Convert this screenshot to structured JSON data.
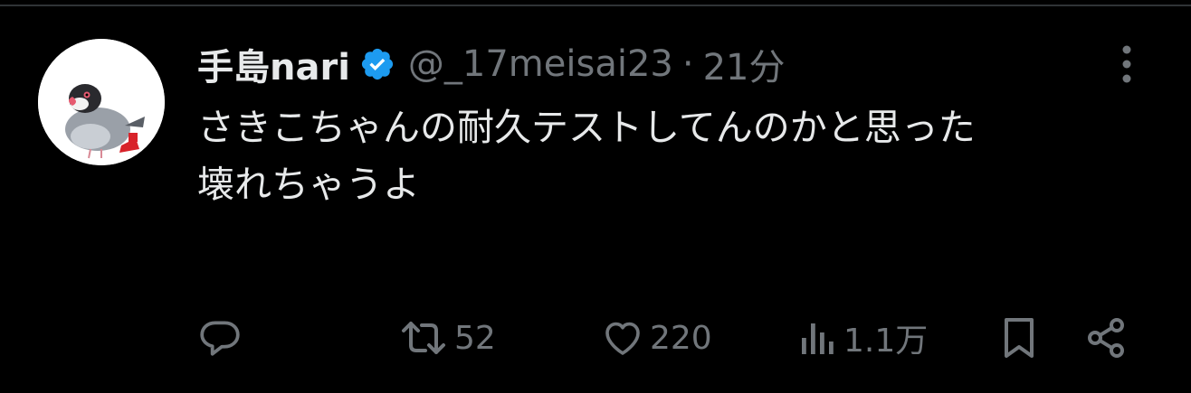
{
  "tweet": {
    "author": {
      "display_name": "手島nari",
      "handle": "@_17meisai23",
      "verified": true,
      "avatar_icon": "java-sparrow-avatar"
    },
    "separator": "·",
    "time": "21分",
    "text": "さきこちゃんの耐久テストしてんのかと思った\n壊れちゃうよ",
    "actions": {
      "reply": {
        "icon": "reply-icon",
        "count": ""
      },
      "retweet": {
        "icon": "retweet-icon",
        "count": "52"
      },
      "like": {
        "icon": "heart-icon",
        "count": "220"
      },
      "views": {
        "icon": "views-icon",
        "count": "1.1万"
      },
      "bookmark": {
        "icon": "bookmark-icon"
      },
      "share": {
        "icon": "share-icon"
      }
    },
    "more_icon": "more-vertical-icon"
  },
  "colors": {
    "background": "#000000",
    "primary_text": "#e7e9ea",
    "secondary_text": "#71767b",
    "verified_badge": "#1d9bf0",
    "border": "#2f3336"
  }
}
